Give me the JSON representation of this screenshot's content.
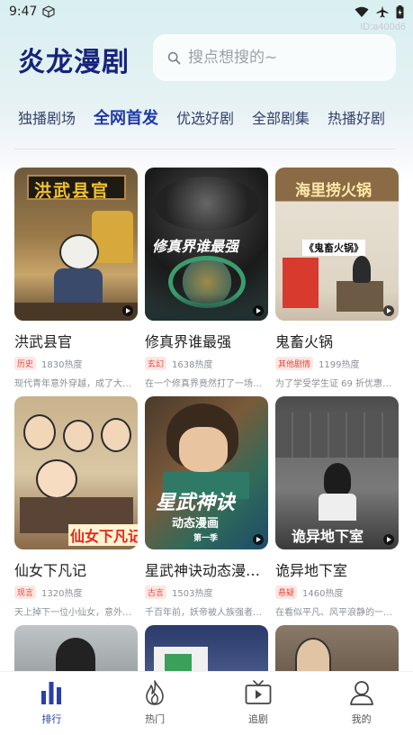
{
  "status_bar": {
    "time": "9:47"
  },
  "watermark": "ID:a400d6",
  "header": {
    "app_title": "炎龙漫剧"
  },
  "search": {
    "placeholder": "搜点想搜的~"
  },
  "tabs": [
    {
      "label": "独播剧场",
      "active": false
    },
    {
      "label": "全网首发",
      "active": true
    },
    {
      "label": "优选好剧",
      "active": false
    },
    {
      "label": "全部剧集",
      "active": false
    },
    {
      "label": "热播好剧",
      "active": false
    }
  ],
  "cards": [
    {
      "name": "洪武县官",
      "tag": "历史",
      "heat": "1830热度",
      "desc": "现代青年意外穿越，成了大明…",
      "cover_text": "洪武县官"
    },
    {
      "name": "修真界谁最强",
      "tag": "玄幻",
      "heat": "1638热度",
      "desc": "在一个修真界竟然打了一场数…",
      "cover_text": "修真界谁最强"
    },
    {
      "name": "鬼畜火锅",
      "tag": "其他剧情",
      "heat": "1199热度",
      "desc": "为了学受学生证 69 折优惠，…",
      "cover_text": "海里捞火锅",
      "cover_sub": "《鬼畜火锅》"
    },
    {
      "name": "仙女下凡记",
      "tag": "现言",
      "heat": "1320热度",
      "desc": "天上掉下一位小仙女，意外被…",
      "cover_text": "仙女下凡记"
    },
    {
      "name": "星武神诀动态漫…",
      "tag": "古言",
      "heat": "1503热度",
      "desc": "千百年前，妖帝被人族强者所…",
      "cover_text": "星武神诀",
      "cover_sub": "动态漫画",
      "cover_sub2": "第一季"
    },
    {
      "name": "诡异地下室",
      "tag": "悬疑",
      "heat": "1460热度",
      "desc": "在看似平凡、风平浪静的一天…",
      "cover_text": "诡异地下室"
    }
  ],
  "bottom_nav": [
    {
      "label": "排行",
      "icon": "bar-chart-icon",
      "active": true
    },
    {
      "label": "热门",
      "icon": "flame-icon",
      "active": false
    },
    {
      "label": "追剧",
      "icon": "tv-play-icon",
      "active": false
    },
    {
      "label": "我的",
      "icon": "user-icon",
      "active": false
    }
  ],
  "colors": {
    "brand": "#17237a",
    "active_tab": "#1e3aa8",
    "tag_red": "#e8493b"
  }
}
